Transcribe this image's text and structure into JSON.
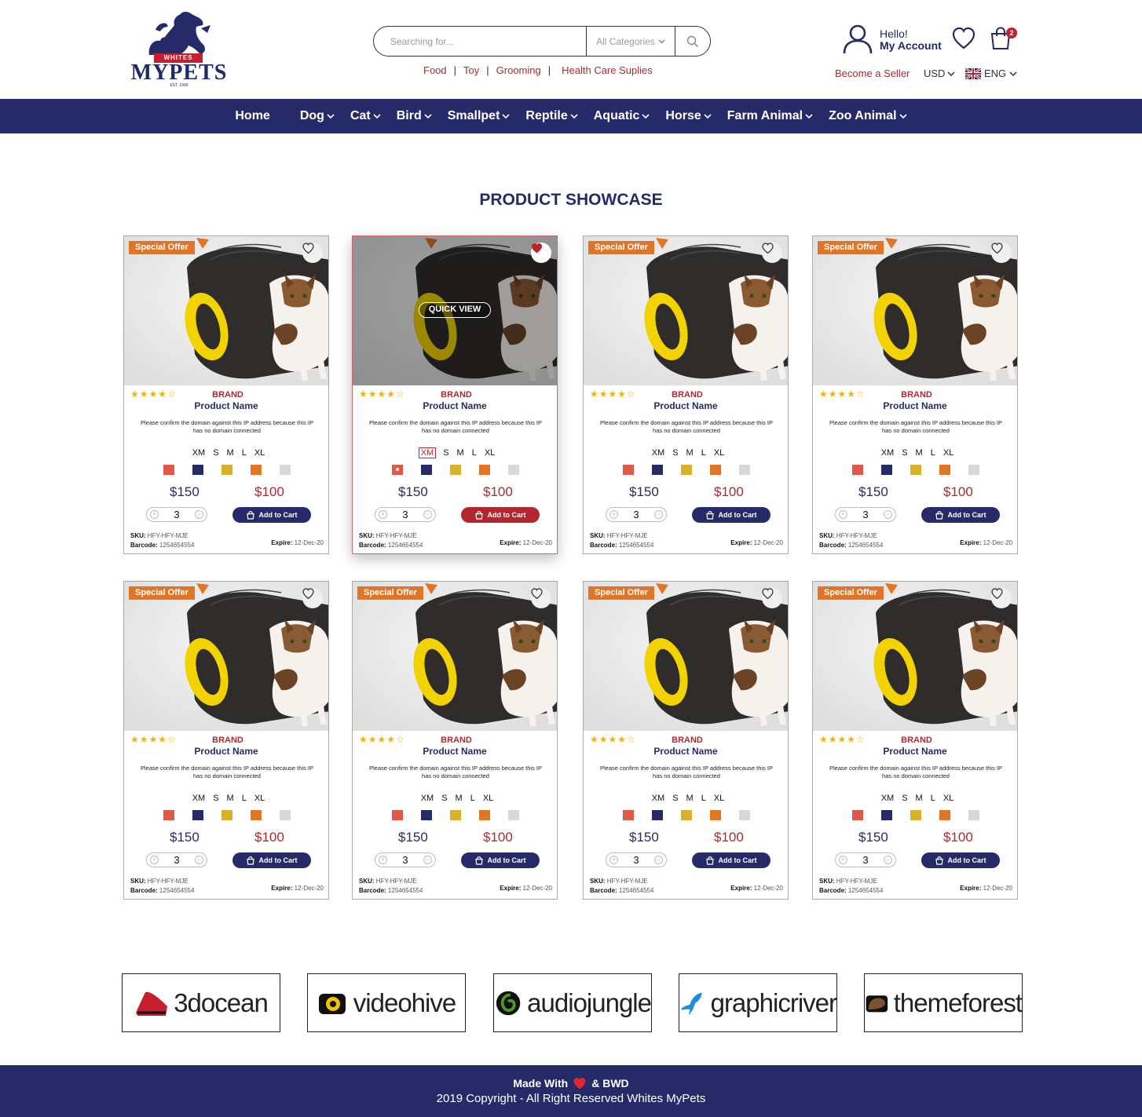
{
  "header": {
    "logo_text": "MYPETS",
    "logo_badge": "WHITES",
    "logo_est": "EST. 1990",
    "search_placeholder": "Searching for...",
    "category_select": "All Categories",
    "quick_links": [
      "Food",
      "Toy",
      "Grooming",
      "Health Care Suplies"
    ],
    "greeting": "Hello!",
    "account_label": "My Account",
    "cart_count": "2",
    "become_seller": "Become a Seller",
    "currency": "USD",
    "language": "ENG"
  },
  "nav": {
    "items": [
      {
        "label": "Home",
        "dropdown": false
      },
      {
        "label": "Dog",
        "dropdown": true
      },
      {
        "label": "Cat",
        "dropdown": true
      },
      {
        "label": "Bird",
        "dropdown": true
      },
      {
        "label": "Smallpet",
        "dropdown": true
      },
      {
        "label": "Reptile",
        "dropdown": true
      },
      {
        "label": "Aquatic",
        "dropdown": true
      },
      {
        "label": "Horse",
        "dropdown": true
      },
      {
        "label": "Farm Animal",
        "dropdown": true
      },
      {
        "label": "Zoo Animal",
        "dropdown": true
      }
    ]
  },
  "showcase": {
    "title": "PRODUCT SHOWCASE",
    "offer_label": "Special Offer",
    "quick_view": "QUICK VIEW",
    "stars": "★★★★☆",
    "rating": 4,
    "sizes": [
      "XM",
      "S",
      "M",
      "L",
      "XL"
    ],
    "swatches": [
      "#de5a47",
      "#252b69",
      "#d9b02c",
      "#e27426",
      "#d8d8d8"
    ],
    "products": [
      {
        "brand": "BRAND",
        "name": "Product Name",
        "description": "Please confirm the domain against this IP address because this IP has no domain connected",
        "old_price": "$150",
        "price": "$100",
        "qty": "3",
        "add_label": "Add to Cart",
        "sku_label": "SKU:",
        "sku": "HFY-HFY-MJE",
        "barcode_label": "Barcode:",
        "barcode": "1254654554",
        "expire_label": "Expire:",
        "expire": "12-Dec-20",
        "special": true,
        "wishlisted": false,
        "active": false
      },
      {
        "brand": "BRAND",
        "name": "Product Name",
        "description": "Please confirm the domain against this IP address because this IP has no domain connected",
        "old_price": "$150",
        "price": "$100",
        "qty": "3",
        "add_label": "Add to Cart",
        "sku_label": "SKU:",
        "sku": "HFY-HFY-MJE",
        "barcode_label": "Barcode:",
        "barcode": "1254654554",
        "expire_label": "Expire:",
        "expire": "12-Dec-20",
        "special": false,
        "wishlisted": true,
        "active": true
      },
      {
        "brand": "BRAND",
        "name": "Product Name",
        "description": "Please confirm the domain against this IP address because this IP has no domain connected",
        "old_price": "$150",
        "price": "$100",
        "qty": "3",
        "add_label": "Add to Cart",
        "sku_label": "SKU:",
        "sku": "HFY-HFY-MJE",
        "barcode_label": "Barcode:",
        "barcode": "1254654554",
        "expire_label": "Expire:",
        "expire": "12-Dec-20",
        "special": true,
        "wishlisted": false,
        "active": false
      },
      {
        "brand": "BRAND",
        "name": "Product Name",
        "description": "Please confirm the domain against this IP address because this IP has no domain connected",
        "old_price": "$150",
        "price": "$100",
        "qty": "3",
        "add_label": "Add to Cart",
        "sku_label": "SKU:",
        "sku": "HFY-HFY-MJE",
        "barcode_label": "Barcode:",
        "barcode": "1254654554",
        "expire_label": "Expire:",
        "expire": "12-Dec-20",
        "special": true,
        "wishlisted": false,
        "active": false
      },
      {
        "brand": "BRAND",
        "name": "Product Name",
        "description": "Please confirm the domain against this IP address because this IP has no domain connected",
        "old_price": "$150",
        "price": "$100",
        "qty": "3",
        "add_label": "Add to Cart",
        "sku_label": "SKU:",
        "sku": "HFY-HFY-MJE",
        "barcode_label": "Barcode:",
        "barcode": "1254654554",
        "expire_label": "Expire:",
        "expire": "12-Dec-20",
        "special": true,
        "wishlisted": false,
        "active": false
      },
      {
        "brand": "BRAND",
        "name": "Product Name",
        "description": "Please confirm the domain against this IP address because this IP has no domain connected",
        "old_price": "$150",
        "price": "$100",
        "qty": "3",
        "add_label": "Add to Cart",
        "sku_label": "SKU:",
        "sku": "HFY-HFY-MJE",
        "barcode_label": "Barcode:",
        "barcode": "1254654554",
        "expire_label": "Expire:",
        "expire": "12-Dec-20",
        "special": true,
        "wishlisted": false,
        "active": false
      },
      {
        "brand": "BRAND",
        "name": "Product Name",
        "description": "Please confirm the domain against this IP address because this IP has no domain connected",
        "old_price": "$150",
        "price": "$100",
        "qty": "3",
        "add_label": "Add to Cart",
        "sku_label": "SKU:",
        "sku": "HFY-HFY-MJE",
        "barcode_label": "Barcode:",
        "barcode": "1254654554",
        "expire_label": "Expire:",
        "expire": "12-Dec-20",
        "special": true,
        "wishlisted": false,
        "active": false
      },
      {
        "brand": "BRAND",
        "name": "Product Name",
        "description": "Please confirm the domain against this IP address because this IP has no domain connected",
        "old_price": "$150",
        "price": "$100",
        "qty": "3",
        "add_label": "Add to Cart",
        "sku_label": "SKU:",
        "sku": "HFY-HFY-MJE",
        "barcode_label": "Barcode:",
        "barcode": "1254654554",
        "expire_label": "Expire:",
        "expire": "12-Dec-20",
        "special": true,
        "wishlisted": false,
        "active": false
      }
    ]
  },
  "partners": [
    {
      "name": "3docean",
      "icon": "3docean-logo-icon",
      "color": "#c41f2f"
    },
    {
      "name": "videohive",
      "icon": "videohive-logo-icon",
      "color": "#f2c200"
    },
    {
      "name": "audiojungle",
      "icon": "audiojungle-logo-icon",
      "color": "#4a9a2a"
    },
    {
      "name": "graphicriver",
      "icon": "graphicriver-logo-icon",
      "color": "#1b8fd6"
    },
    {
      "name": "themeforest",
      "icon": "themeforest-logo-icon",
      "color": "#7a5230"
    }
  ],
  "footer": {
    "made_with": "Made With",
    "made_by": "& BWD",
    "copyright": "2019 Copyright  - All Right Reserved Whites MyPets"
  },
  "colors": {
    "navy": "#252b69",
    "red": "#b3262e",
    "orange": "#e27426"
  }
}
